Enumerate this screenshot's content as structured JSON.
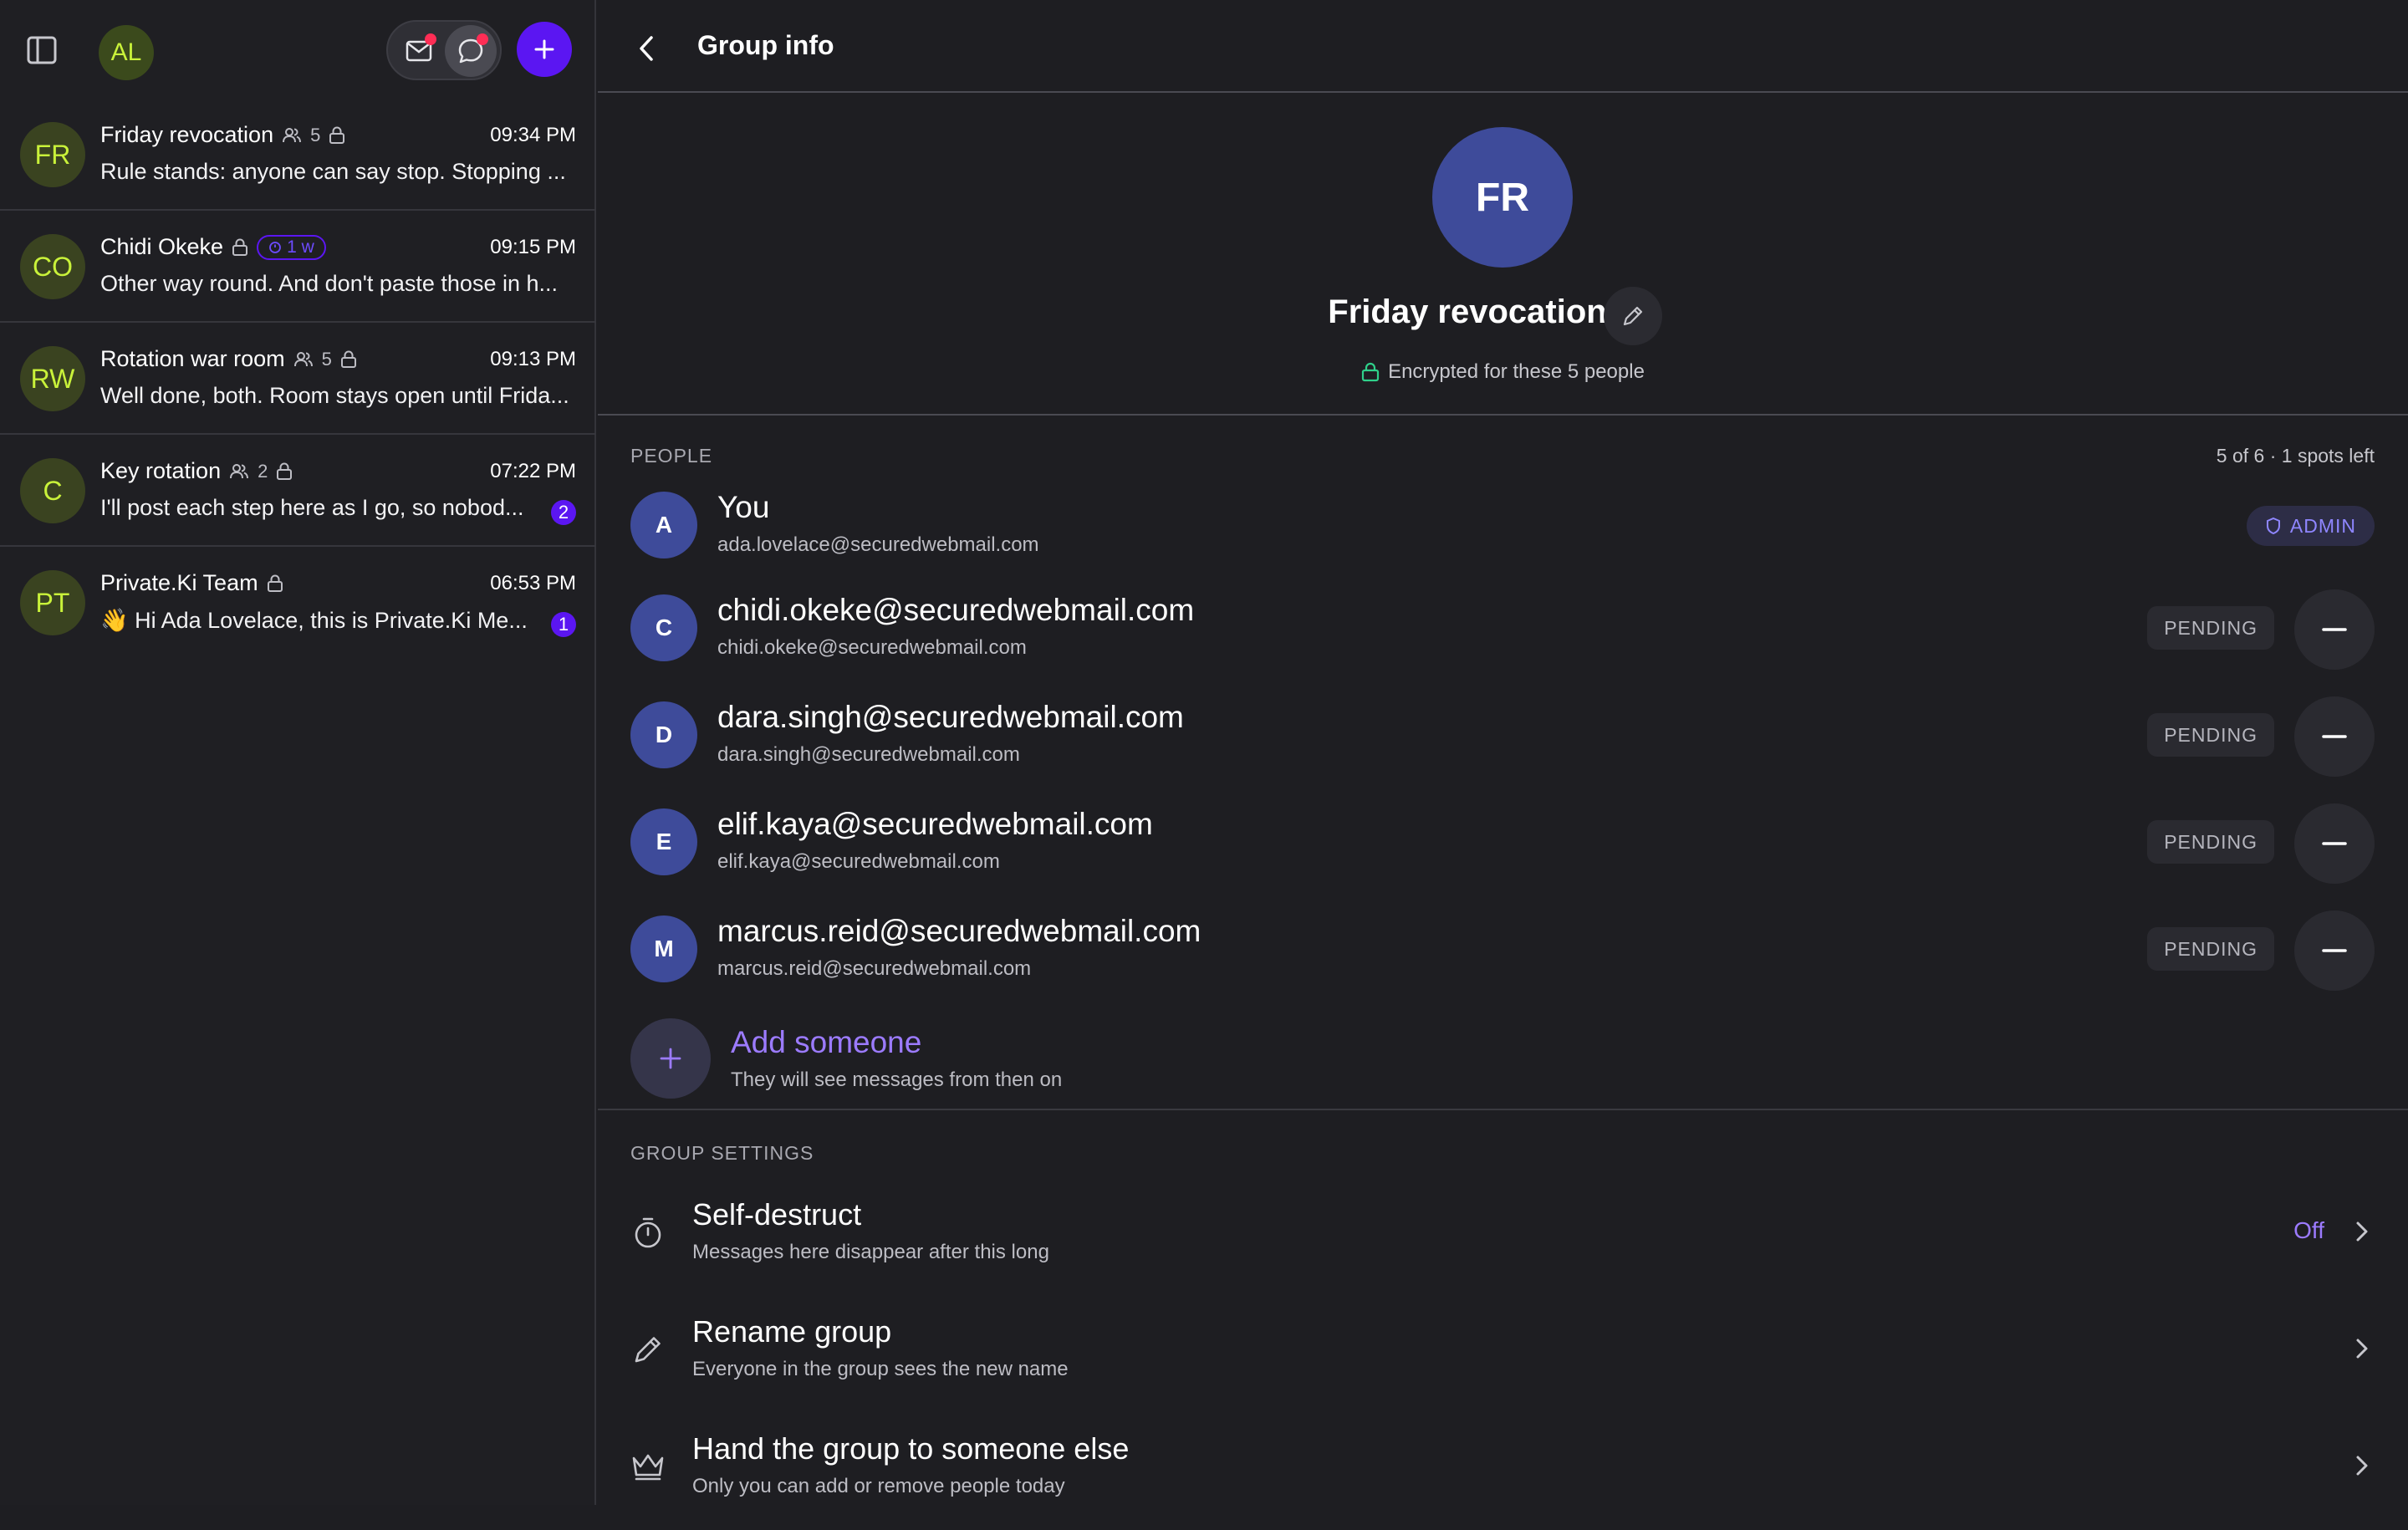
{
  "sidebar": {
    "me_initials": "AL",
    "conversations": [
      {
        "initials": "FR",
        "name": "Friday revocation",
        "member_count": "5",
        "time": "09:34 PM",
        "preview": "Rule stands: anyone can say stop. Stopping ..."
      },
      {
        "initials": "CO",
        "name": "Chidi Okeke",
        "timer": "1 w",
        "time": "09:15 PM",
        "preview": "Other way round. And don't paste those in h..."
      },
      {
        "initials": "RW",
        "name": "Rotation war room",
        "member_count": "5",
        "time": "09:13 PM",
        "preview": "Well done, both. Room stays open until Frida..."
      },
      {
        "initials": "C",
        "name": "Key rotation",
        "member_count": "2",
        "time": "07:22 PM",
        "preview": "I'll post each step here as I go, so nobod...",
        "unread": "2"
      },
      {
        "initials": "PT",
        "name": "Private.Ki Team",
        "time": "06:53 PM",
        "preview": "👋 Hi Ada Lovelace, this is Private.Ki Me...",
        "unread": "1"
      }
    ]
  },
  "header": {
    "title": "Group info"
  },
  "group": {
    "initials": "FR",
    "name": "Friday revocation",
    "encryption_note": "Encrypted for these 5 people"
  },
  "people": {
    "section_label": "PEOPLE",
    "spots": "5 of 6 · 1 spots left",
    "admin_label": "ADMIN",
    "pending_label": "PENDING",
    "members": [
      {
        "initial": "A",
        "name": "You",
        "email": "ada.lovelace@securedwebmail.com"
      },
      {
        "initial": "C",
        "name": "chidi.okeke@securedwebmail.com",
        "email": "chidi.okeke@securedwebmail.com"
      },
      {
        "initial": "D",
        "name": "dara.singh@securedwebmail.com",
        "email": "dara.singh@securedwebmail.com"
      },
      {
        "initial": "E",
        "name": "elif.kaya@securedwebmail.com",
        "email": "elif.kaya@securedwebmail.com"
      },
      {
        "initial": "M",
        "name": "marcus.reid@securedwebmail.com",
        "email": "marcus.reid@securedwebmail.com"
      }
    ],
    "add": {
      "title": "Add someone",
      "subtitle": "They will see messages from then on"
    }
  },
  "settings": {
    "section_label": "GROUP SETTINGS",
    "items": [
      {
        "title": "Self-destruct",
        "subtitle": "Messages here disappear after this long",
        "value": "Off",
        "icon": "timer-icon"
      },
      {
        "title": "Rename group",
        "subtitle": "Everyone in the group sees the new name",
        "icon": "pencil-icon"
      },
      {
        "title": "Hand the group to someone else",
        "subtitle": "Only you can add or remove people today",
        "icon": "crown-icon"
      }
    ]
  },
  "colors": {
    "accent": "#5b16f2",
    "link": "#9c7bff",
    "avatar_blue": "#3e4b9a",
    "avatar_green_text": "#c9f23a",
    "notify_dot": "#ff2d55"
  }
}
